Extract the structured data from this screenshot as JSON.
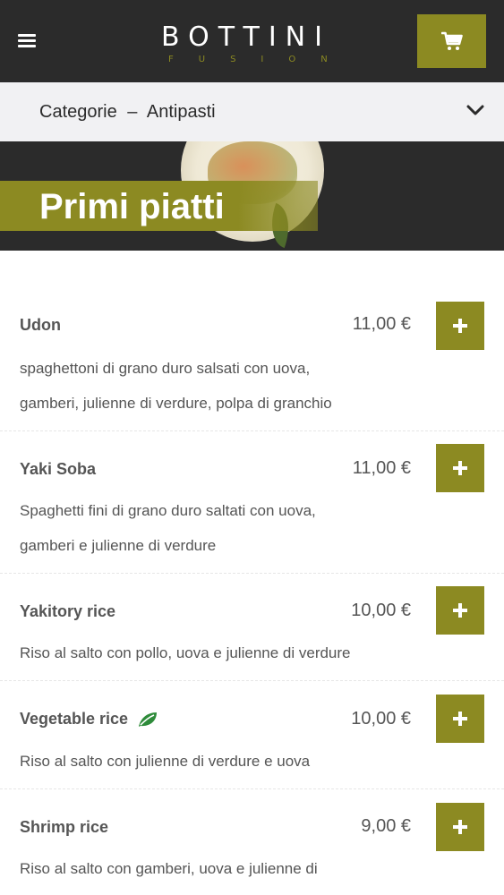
{
  "header": {
    "logo_main": "BOTTINI",
    "logo_sub": "FUSION",
    "menu_icon": "hamburger-icon",
    "cart_icon": "cart-icon"
  },
  "category": {
    "label": "Categorie",
    "separator": "–",
    "current": "Antipasti",
    "chevron_icon": "chevron-down-icon"
  },
  "hero": {
    "title": "Primi piatti"
  },
  "colors": {
    "accent": "#8c8a22",
    "dark": "#2b2b2b",
    "text": "#555555",
    "leaf": "#2e8b3a"
  },
  "items": [
    {
      "name": "Udon",
      "price": "11,00 €",
      "desc_line1": "spaghettoni di grano duro salsati con uova,",
      "desc_line2": "gamberi, julienne di verdure, polpa di granchio",
      "vegetarian": false
    },
    {
      "name": "Yaki Soba",
      "price": "11,00 €",
      "desc_line1": "Spaghetti fini di grano duro saltati con uova,",
      "desc_line2": "gamberi e julienne di verdure",
      "vegetarian": false
    },
    {
      "name": "Yakitory rice",
      "price": "10,00 €",
      "desc_line1": "Riso al salto con pollo, uova e julienne di verdure",
      "desc_line2": "",
      "vegetarian": false
    },
    {
      "name": "Vegetable rice",
      "price": "10,00 €",
      "desc_line1": "Riso al salto con julienne di verdure e uova",
      "desc_line2": "",
      "vegetarian": true
    },
    {
      "name": "Shrimp rice",
      "price": "9,00 €",
      "desc_line1": "Riso al salto con gamberi, uova e julienne di",
      "desc_line2": "",
      "vegetarian": false
    }
  ]
}
